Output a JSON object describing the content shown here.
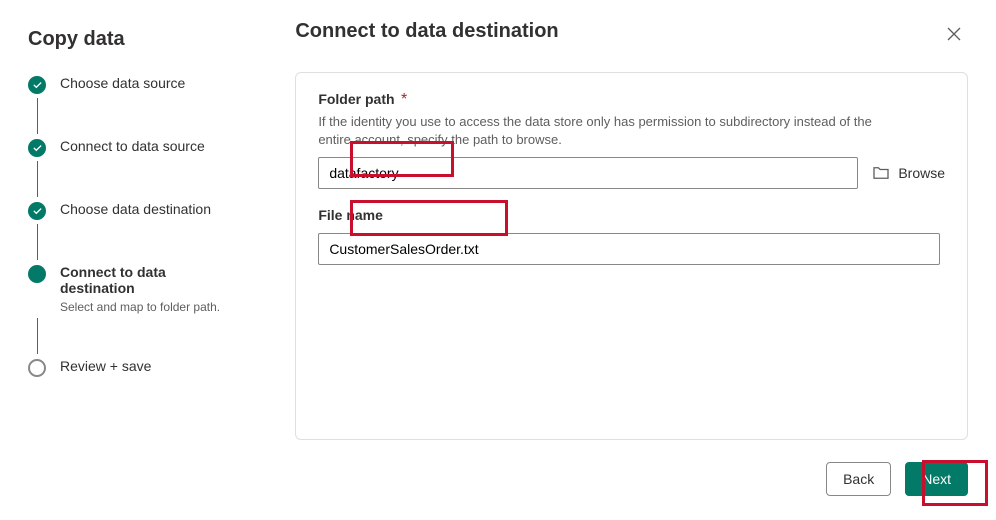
{
  "sidebar": {
    "title": "Copy data",
    "steps": [
      {
        "label": "Choose data source",
        "state": "done"
      },
      {
        "label": "Connect to data source",
        "state": "done"
      },
      {
        "label": "Choose data destination",
        "state": "done"
      },
      {
        "label": "Connect to data destination",
        "sublabel": "Select and map to folder path.",
        "state": "current"
      },
      {
        "label": "Review + save",
        "state": "pending"
      }
    ]
  },
  "main": {
    "title": "Connect to data destination",
    "folder_path": {
      "label": "Folder path",
      "required_marker": "*",
      "description": "If the identity you use to access the data store only has permission to subdirectory instead of the entire account, specify the path to browse.",
      "value": "datafactory",
      "browse_label": "Browse"
    },
    "file_name": {
      "label": "File name",
      "value": "CustomerSalesOrder.txt"
    }
  },
  "footer": {
    "back": "Back",
    "next": "Next"
  }
}
